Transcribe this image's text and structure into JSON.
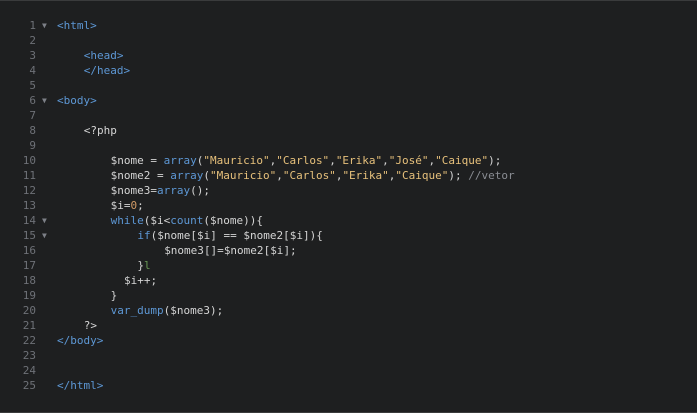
{
  "editor": {
    "lines": [
      {
        "n": "1",
        "fold": true,
        "indent": 0,
        "tokens": [
          {
            "t": "tag",
            "v": "<html>"
          }
        ]
      },
      {
        "n": "2",
        "fold": false,
        "indent": 0,
        "tokens": []
      },
      {
        "n": "3",
        "fold": false,
        "indent": 4,
        "tokens": [
          {
            "t": "tag",
            "v": "<head>"
          }
        ]
      },
      {
        "n": "4",
        "fold": false,
        "indent": 4,
        "tokens": [
          {
            "t": "tag",
            "v": "</head>"
          }
        ]
      },
      {
        "n": "5",
        "fold": false,
        "indent": 0,
        "tokens": []
      },
      {
        "n": "6",
        "fold": true,
        "indent": 0,
        "tokens": [
          {
            "t": "tag",
            "v": "<body>"
          }
        ]
      },
      {
        "n": "7",
        "fold": false,
        "indent": 0,
        "tokens": []
      },
      {
        "n": "8",
        "fold": false,
        "indent": 4,
        "tokens": [
          {
            "t": "pl",
            "v": "<?php"
          }
        ]
      },
      {
        "n": "9",
        "fold": false,
        "indent": 0,
        "tokens": []
      },
      {
        "n": "10",
        "fold": false,
        "indent": 8,
        "tokens": [
          {
            "t": "var",
            "v": "$nome"
          },
          {
            "t": "pl",
            "v": " = "
          },
          {
            "t": "kw",
            "v": "array"
          },
          {
            "t": "pl",
            "v": "("
          },
          {
            "t": "str",
            "v": "\"Mauricio\""
          },
          {
            "t": "pl",
            "v": ","
          },
          {
            "t": "str",
            "v": "\"Carlos\""
          },
          {
            "t": "pl",
            "v": ","
          },
          {
            "t": "str",
            "v": "\"Erika\""
          },
          {
            "t": "pl",
            "v": ","
          },
          {
            "t": "str",
            "v": "\"José\""
          },
          {
            "t": "pl",
            "v": ","
          },
          {
            "t": "str",
            "v": "\"Caique\""
          },
          {
            "t": "pl",
            "v": ");"
          }
        ]
      },
      {
        "n": "11",
        "fold": false,
        "indent": 8,
        "tokens": [
          {
            "t": "var",
            "v": "$nome2"
          },
          {
            "t": "pl",
            "v": " = "
          },
          {
            "t": "kw",
            "v": "array"
          },
          {
            "t": "pl",
            "v": "("
          },
          {
            "t": "str",
            "v": "\"Mauricio\""
          },
          {
            "t": "pl",
            "v": ","
          },
          {
            "t": "str",
            "v": "\"Carlos\""
          },
          {
            "t": "pl",
            "v": ","
          },
          {
            "t": "str",
            "v": "\"Erika\""
          },
          {
            "t": "pl",
            "v": ","
          },
          {
            "t": "str",
            "v": "\"Caique\""
          },
          {
            "t": "pl",
            "v": "); "
          },
          {
            "t": "cmt",
            "v": "//vetor"
          }
        ]
      },
      {
        "n": "12",
        "fold": false,
        "indent": 8,
        "tokens": [
          {
            "t": "var",
            "v": "$nome3"
          },
          {
            "t": "pl",
            "v": "="
          },
          {
            "t": "kw",
            "v": "array"
          },
          {
            "t": "pl",
            "v": "();"
          }
        ]
      },
      {
        "n": "13",
        "fold": false,
        "indent": 8,
        "tokens": [
          {
            "t": "var",
            "v": "$i"
          },
          {
            "t": "pl",
            "v": "="
          },
          {
            "t": "num",
            "v": "0"
          },
          {
            "t": "pl",
            "v": ";"
          }
        ]
      },
      {
        "n": "14",
        "fold": true,
        "indent": 8,
        "tokens": [
          {
            "t": "kw",
            "v": "while"
          },
          {
            "t": "pl",
            "v": "("
          },
          {
            "t": "var",
            "v": "$i"
          },
          {
            "t": "pl",
            "v": "<"
          },
          {
            "t": "kw",
            "v": "count"
          },
          {
            "t": "pl",
            "v": "("
          },
          {
            "t": "var",
            "v": "$nome"
          },
          {
            "t": "pl",
            "v": ")){"
          }
        ]
      },
      {
        "n": "15",
        "fold": true,
        "indent": 12,
        "tokens": [
          {
            "t": "kw",
            "v": "if"
          },
          {
            "t": "pl",
            "v": "("
          },
          {
            "t": "var",
            "v": "$nome"
          },
          {
            "t": "pl",
            "v": "["
          },
          {
            "t": "var",
            "v": "$i"
          },
          {
            "t": "pl",
            "v": "] == "
          },
          {
            "t": "var",
            "v": "$nome2"
          },
          {
            "t": "pl",
            "v": "["
          },
          {
            "t": "var",
            "v": "$i"
          },
          {
            "t": "pl",
            "v": "]){"
          }
        ]
      },
      {
        "n": "16",
        "fold": false,
        "indent": 16,
        "tokens": [
          {
            "t": "var",
            "v": "$nome3"
          },
          {
            "t": "pl",
            "v": "[]="
          },
          {
            "t": "var",
            "v": "$nome2"
          },
          {
            "t": "pl",
            "v": "["
          },
          {
            "t": "var",
            "v": "$i"
          },
          {
            "t": "pl",
            "v": "];"
          }
        ]
      },
      {
        "n": "17",
        "fold": false,
        "indent": 12,
        "tokens": [
          {
            "t": "pl",
            "v": "}"
          },
          {
            "t": "br",
            "v": "l"
          }
        ]
      },
      {
        "n": "18",
        "fold": false,
        "indent": 10,
        "tokens": [
          {
            "t": "var",
            "v": "$i"
          },
          {
            "t": "pl",
            "v": "++;"
          }
        ]
      },
      {
        "n": "19",
        "fold": false,
        "indent": 8,
        "tokens": [
          {
            "t": "pl",
            "v": "}"
          }
        ]
      },
      {
        "n": "20",
        "fold": false,
        "indent": 8,
        "tokens": [
          {
            "t": "kw",
            "v": "var_dump"
          },
          {
            "t": "pl",
            "v": "("
          },
          {
            "t": "var",
            "v": "$nome3"
          },
          {
            "t": "pl",
            "v": ");"
          }
        ]
      },
      {
        "n": "21",
        "fold": false,
        "indent": 4,
        "tokens": [
          {
            "t": "pl",
            "v": "?>"
          }
        ]
      },
      {
        "n": "22",
        "fold": false,
        "indent": 0,
        "tokens": [
          {
            "t": "tag",
            "v": "</body>"
          }
        ]
      },
      {
        "n": "23",
        "fold": false,
        "indent": 0,
        "tokens": []
      },
      {
        "n": "24",
        "fold": false,
        "indent": 0,
        "tokens": []
      },
      {
        "n": "25",
        "fold": false,
        "indent": 0,
        "tokens": [
          {
            "t": "tag",
            "v": "</html>"
          }
        ]
      }
    ]
  },
  "colors": {
    "background": "#1e1f20",
    "line_number": "#6e7177",
    "tag": "#5d97d4",
    "keyword": "#5d97d4",
    "string": "#e6c07b",
    "number": "#d19a66",
    "comment": "#8a8d93",
    "text": "#d4d4d4"
  },
  "icons": {
    "fold": "fold-arrow-icon"
  }
}
